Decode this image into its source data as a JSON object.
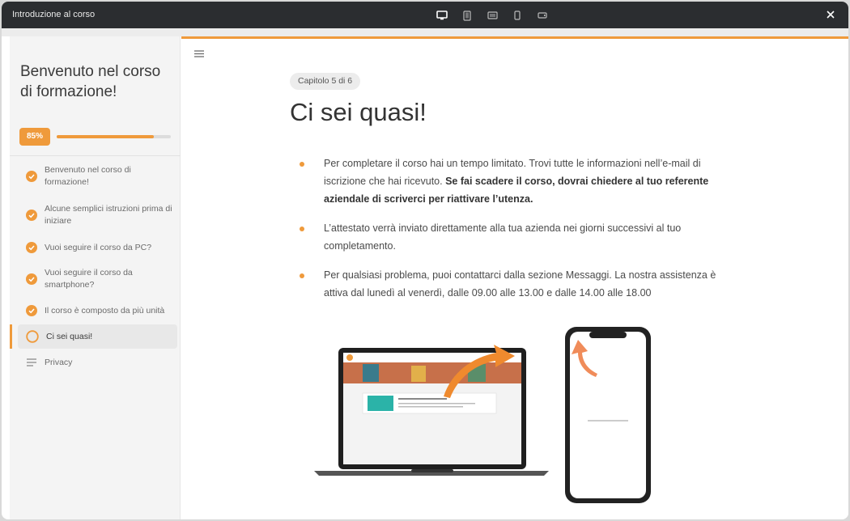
{
  "window": {
    "title": "Introduzione al corso"
  },
  "device_icons": [
    "desktop-icon",
    "tablet-icon",
    "tablet-landscape-icon",
    "phone-icon",
    "phone-landscape-icon"
  ],
  "sidebar": {
    "course_title": "Benvenuto nel corso di formazione!",
    "progress": {
      "label": "85%",
      "value": 0.85
    },
    "lessons": [
      {
        "label": "Benvenuto nel corso di formazione!",
        "status": "complete"
      },
      {
        "label": "Alcune semplici istruzioni prima di iniziare",
        "status": "complete"
      },
      {
        "label": "Vuoi seguire il corso da PC?",
        "status": "complete"
      },
      {
        "label": "Vuoi seguire il corso da smartphone?",
        "status": "complete"
      },
      {
        "label": "Il corso è composto da più unità",
        "status": "complete"
      },
      {
        "label": "Ci sei quasi!",
        "status": "current"
      },
      {
        "label": "Privacy",
        "status": "text-lesson"
      }
    ]
  },
  "main": {
    "chapter_badge": "Capitolo 5 di 6",
    "heading": "Ci sei quasi!",
    "bullets": [
      {
        "text": "Per completare il corso hai un tempo limitato. Trovi tutte le informazioni nell’e-mail di iscrizione che hai ricevuto. ",
        "bold": "Se fai scadere il corso, dovrai chiedere al tuo referente aziendale di scriverci per riattivare l’utenza."
      },
      {
        "text": "L’attestato verrà inviato direttamente alla tua azienda nei giorni successivi al tuo completamento.",
        "bold": ""
      },
      {
        "text": "Per qualsiasi problema, puoi contattarci dalla sezione Messaggi. La nostra assistenza è attiva dal lunedì al venerdì, dalle 09.00 alle 13.00 e dalle 14.00 alle 18.00",
        "bold": ""
      }
    ]
  },
  "colors": {
    "accent": "#ef9a3b",
    "titlebar": "#2b2d30",
    "sidebar_bg": "#f4f4f4"
  }
}
